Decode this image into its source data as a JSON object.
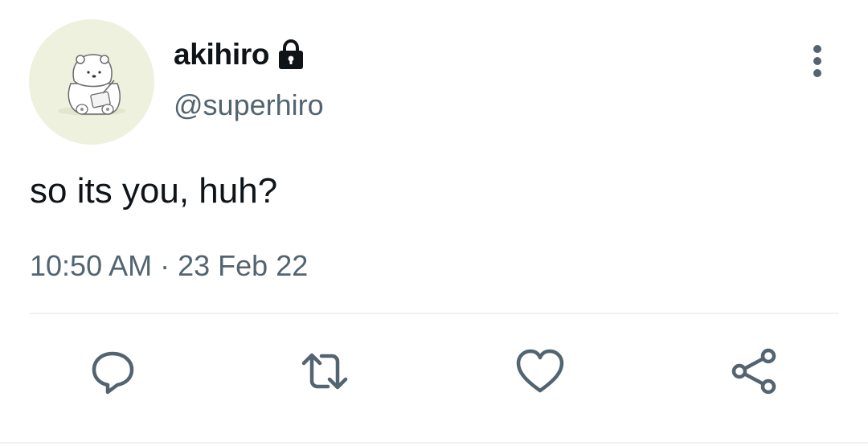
{
  "author": {
    "display_name": "akihiro",
    "handle": "@superhiro",
    "avatar_icon": "polar-bear-avatar",
    "protected_icon": "lock-icon"
  },
  "tweet": {
    "text": "so its you, huh?",
    "time": "10:50 AM",
    "separator": "·",
    "date": "23 Feb 22"
  },
  "actions": {
    "more_icon": "more-vertical-icon",
    "reply_icon": "reply-icon",
    "retweet_icon": "retweet-icon",
    "like_icon": "heart-icon",
    "share_icon": "share-icon"
  },
  "colors": {
    "text_primary": "#0f1419",
    "text_secondary": "#536471",
    "avatar_bg": "#eef1dd",
    "divider": "#eff3f4"
  }
}
